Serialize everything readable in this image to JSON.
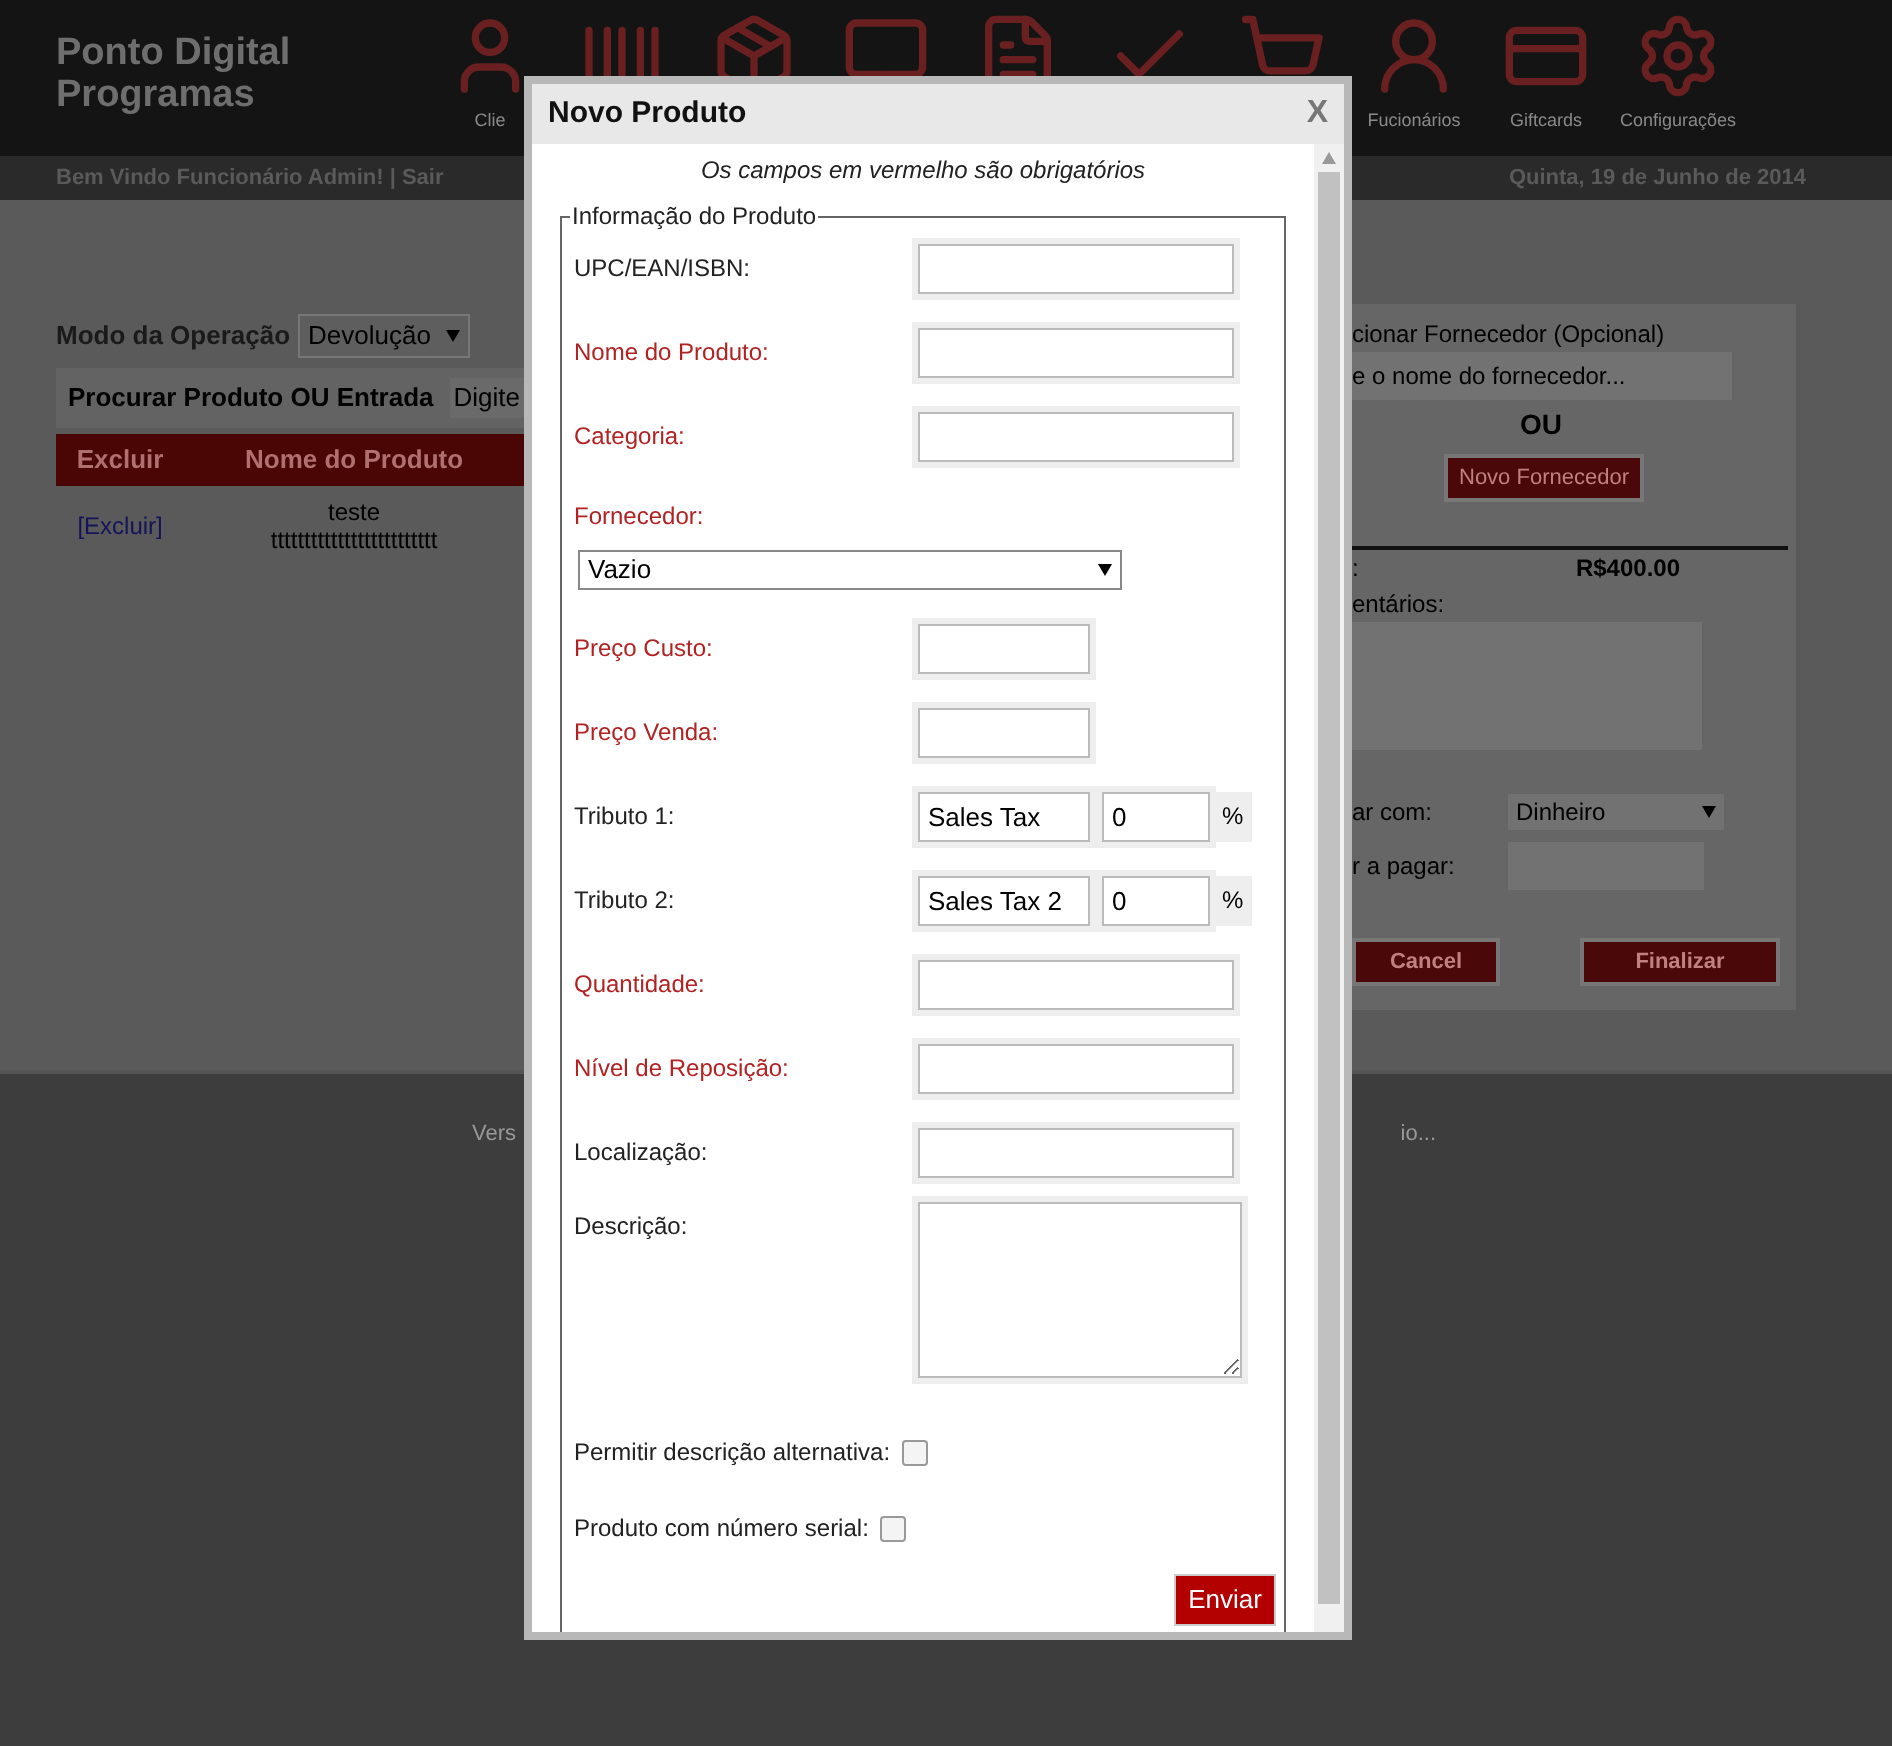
{
  "header": {
    "logo": [
      "Ponto Digital",
      "Programas"
    ],
    "nav": [
      {
        "kind": "user",
        "label": "Clie"
      },
      {
        "kind": "barcode"
      },
      {
        "kind": "box"
      },
      {
        "kind": "monitor"
      },
      {
        "kind": "file"
      },
      {
        "kind": "check"
      },
      {
        "kind": "cart"
      },
      {
        "kind": "employee",
        "label": "Fucionários"
      },
      {
        "kind": "card",
        "label": "Giftcards"
      },
      {
        "kind": "gear",
        "label": "Configurações"
      }
    ],
    "welcome": "Bem Vindo Funcionário Admin! | Sair",
    "date": "Quinta, 19 de Junho de 2014"
  },
  "left_panel": {
    "mode_label": "Modo da Operação",
    "mode_value": "Devolução",
    "search_label": "Procurar Produto OU Entrada",
    "search_value": "Digite",
    "columns": [
      "Excluir",
      "Nome do Produto"
    ],
    "rows": [
      {
        "action": "[Excluir]",
        "name": [
          "teste",
          "ttttttttttttttttttttttttt"
        ]
      }
    ]
  },
  "right_panel": {
    "supplier_label": "cionar Fornecedor (Opcional)",
    "supplier_placeholder": "e o nome do fornecedor...",
    "or": "OU",
    "new_supplier": "Novo Fornecedor",
    "total_label": ":",
    "total": "R$400.00",
    "comments_label": "entários:",
    "pay_label": "ar com:",
    "pay_value": "Dinheiro",
    "amount_label": "r a pagar:",
    "cancel": "Cancel",
    "finish": "Finalizar"
  },
  "footer": {
    "left": "Vers",
    "right": "io..."
  },
  "modal": {
    "title": "Novo Produto",
    "close": "X",
    "note": "Os campos em vermelho são obrigatórios",
    "legend": "Informação do Produto",
    "fields": [
      {
        "kind": "text",
        "label": "UPC/EAN/ISBN:",
        "required": false
      },
      {
        "kind": "text",
        "label": "Nome do Produto:",
        "required": true
      },
      {
        "kind": "text",
        "label": "Categoria:",
        "required": true
      },
      {
        "kind": "select",
        "label": "Fornecedor:",
        "required": true,
        "value": "Vazio"
      },
      {
        "kind": "short",
        "label": "Preço Custo:",
        "required": true
      },
      {
        "kind": "short",
        "label": "Preço Venda:",
        "required": true
      },
      {
        "kind": "tax",
        "label": "Tributo 1:",
        "required": false,
        "value": "Sales Tax",
        "percent": "0",
        "unit": "%"
      },
      {
        "kind": "tax",
        "label": "Tributo 2:",
        "required": false,
        "value": "Sales Tax 2",
        "percent": "0",
        "unit": "%"
      },
      {
        "kind": "text",
        "label": "Quantidade:",
        "required": true
      },
      {
        "kind": "text",
        "label": "Nível de Reposição:",
        "required": true
      },
      {
        "kind": "text",
        "label": "Localização:",
        "required": false
      },
      {
        "kind": "textarea",
        "label": "Descrição:",
        "required": false
      },
      {
        "kind": "checkbox",
        "label": "Permitir descrição alternativa:",
        "required": false,
        "checked": false
      },
      {
        "kind": "checkbox",
        "label": "Produto com número serial:",
        "required": false,
        "checked": false
      }
    ],
    "submit": "Enviar"
  }
}
